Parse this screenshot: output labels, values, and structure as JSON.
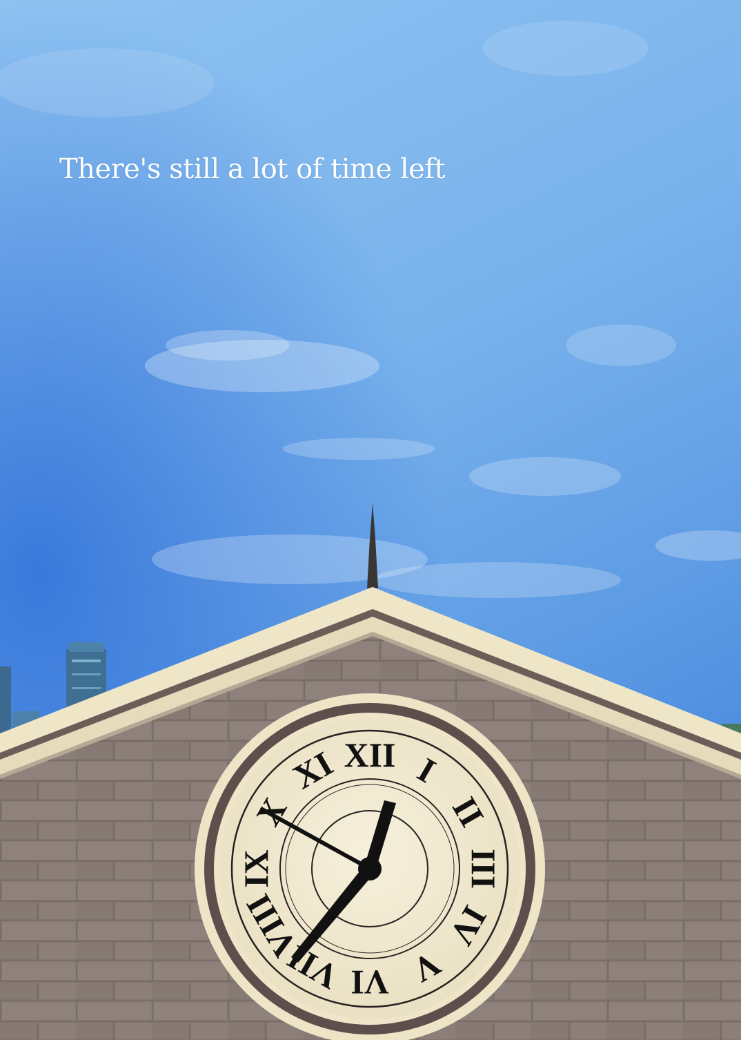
{
  "message": "There's still a lot of time left",
  "clock": {
    "numerals": [
      "XII",
      "I",
      "II",
      "III",
      "IV",
      "V",
      "VI",
      "VII",
      "VIII",
      "IX",
      "X",
      "XI"
    ],
    "hour_hand_icon": "hour-hand",
    "minute_hand_icon": "minute-hand",
    "second_hand_icon": "second-hand"
  },
  "colors": {
    "sky_top": "#86bdf0",
    "sky_bottom": "#3d84de",
    "brick": "#8a7c76",
    "roof_trim": "#ede4c6",
    "roof_dark": "#6f5f5a",
    "clock_face": "#f3ecd4",
    "clock_ring": "#5f4f4c",
    "hands": "#111111"
  }
}
